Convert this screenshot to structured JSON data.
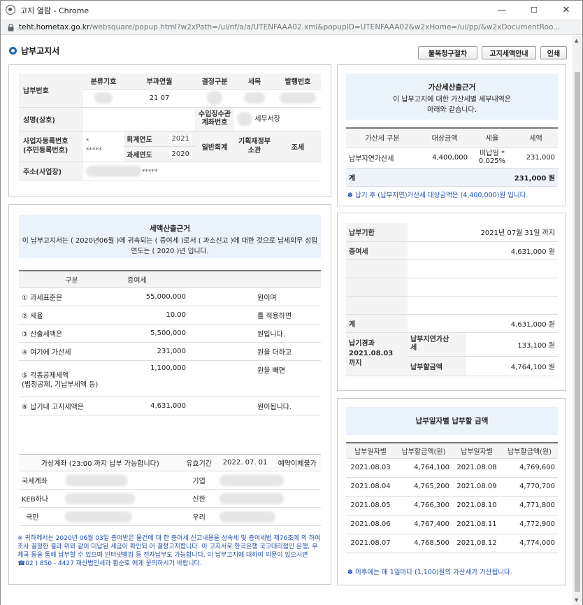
{
  "window": {
    "title": "고지 열람 - Chrome",
    "url_host": "teht.hometax.go.kr",
    "url_path": "/websquare/popup.html?w2xPath=/ui/nf/a/a/UTENFAAA02.xml&popupID=UTENFAAA02&w2xHome=/ui/pp/&w2xDocumentRoo...",
    "min_label": "—",
    "max_label": "☐",
    "close_label": "✕"
  },
  "page": {
    "title": "납부고지서"
  },
  "toolbar": {
    "btn1": "불복청구절차",
    "btn2": "고지세액안내",
    "btn3": "인쇄"
  },
  "info": {
    "tax_no_label": "납부번호",
    "cat_label": "분류기호",
    "period_label": "부과연월",
    "decision_label": "결정구분",
    "item_label": "세목",
    "issue_label": "발행번호",
    "period_value": "21 07",
    "name_label": "성명(상호)",
    "collector_label": "수입징수관\n계좌번호",
    "office_value": "세무서장",
    "bizno_label": "사업자등록번호\n(주민등록번호)",
    "bizno_mask": "*\n*****",
    "acct_year_label": "회계연도",
    "acct_year_value": "2021",
    "general_label": "일반회계",
    "ministry_label": "기획재정부\n소관",
    "tax_label": "조세",
    "tax_year_label": "과세연도",
    "tax_year_value": "2020",
    "addr_label": "주소(사업장)",
    "addr_mask": "*****"
  },
  "calc": {
    "header": "세액산출근거",
    "desc": "이 납부고지서는 ( 2020년06월 )에 귀속되는 ( 증여세 )로서 ( 과소신고 )에 대한 것으로 납세의무 성립연도는 ( 2020 )년 입니다.",
    "col1": "구분",
    "col2": "증여세",
    "rows": [
      {
        "label": "① 과세표준은",
        "value": "55,000,000",
        "suffix": "원이며"
      },
      {
        "label": "② 세율",
        "value": "10.00",
        "suffix": "를 적용하면"
      },
      {
        "label": "③ 산출세액은",
        "value": "5,500,000",
        "suffix": "원입니다."
      },
      {
        "label": "④ 여기에 가산세",
        "value": "231,000",
        "suffix": "원을 더하고"
      },
      {
        "label": "⑤ 각종공제세액\n(법정공제, 기납부세액 등)",
        "value": "1,100,000",
        "suffix": "원을 빼면"
      },
      {
        "label": "⑥ 납기내 고지세액은",
        "value": "4,631,000",
        "suffix": "원이됩니다."
      }
    ]
  },
  "virtual": {
    "header": "가상계좌 (23:00 까지 납부 가능합니다)",
    "expiry_label": "유효기간",
    "expiry_value": "2022. 07. 01",
    "transfer": "예약이체불가",
    "banks": [
      {
        "left": "국세계좌",
        "right": "기업"
      },
      {
        "left": "KEB하나",
        "right": "신한"
      },
      {
        "left": "국민",
        "right": "우리"
      }
    ],
    "note": "※ 귀하께서는 2020년 06월 03일 증여받은 물건에 대 한 증여세 신고내용을 상속세 및 증여세법 제76조에 의 하여 조사 결정한 결과 위와 같이 미납된 세금이 확인되 어 결정고지합니다. 이 고지서로 한국은행 국고대리점인 은행, 우체국 등을 통해 납부할 수 있으며 인터넷뱅킹 등 전자납부도 가능합니다. 이 납부고지에 대하여 의문이 있으시면 ☎02 ) 850 - 4427 재산법인세과 황순호 에게 문의하시기 바랍니다."
  },
  "penalty": {
    "header": "가산세산출근거",
    "desc": "이 납부고지에 대한 가산세별 세부내역은\n아래와 같습니다.",
    "cols": [
      "가산세 구분",
      "대상금액",
      "세율",
      "세액"
    ],
    "row": {
      "type": "납부지연가산세",
      "base": "4,400,000",
      "rate": "미납일 *\n0.025%",
      "amount": "231,000"
    },
    "total_label": "계",
    "total_value": "231,000 원",
    "note": "✽ 납기 후 (납부지연)가산세 대상금액은 (4,400,000)원 입니다."
  },
  "due": {
    "deadline_label": "납부기한",
    "deadline_value": "2021년 07월 31일 까지",
    "gift_label": "증여세",
    "gift_value": "4,631,000 원",
    "total_label": "계",
    "total_value": "4,631,000 원",
    "after_label": "납기경과\n2021.08.03\n까지",
    "late_label": "납부지연가산\n세",
    "late_value": "133,100 원",
    "pay_label": "납부할금액",
    "pay_value": "4,764,100 원"
  },
  "daily": {
    "header": "납부일자별 납부할 금액",
    "cols": [
      "납부일자별",
      "납부할금액(원)",
      "납부일자별",
      "납부할금액(원)"
    ],
    "rows": [
      [
        "2021.08.03",
        "4,764,100",
        "2021.08.08",
        "4,769,600"
      ],
      [
        "2021.08.04",
        "4,765,200",
        "2021.08.09",
        "4,770,700"
      ],
      [
        "2021.08.05",
        "4,766,300",
        "2021.08.10",
        "4,771,800"
      ],
      [
        "2021.08.06",
        "4,767,400",
        "2021.08.11",
        "4,772,900"
      ],
      [
        "2021.08.07",
        "4,768,500",
        "2021.08.12",
        "4,774,000"
      ]
    ],
    "note": "✽ 이후에는 매 1일마다 (1,100)원의 가산세가 가산됩니다."
  }
}
